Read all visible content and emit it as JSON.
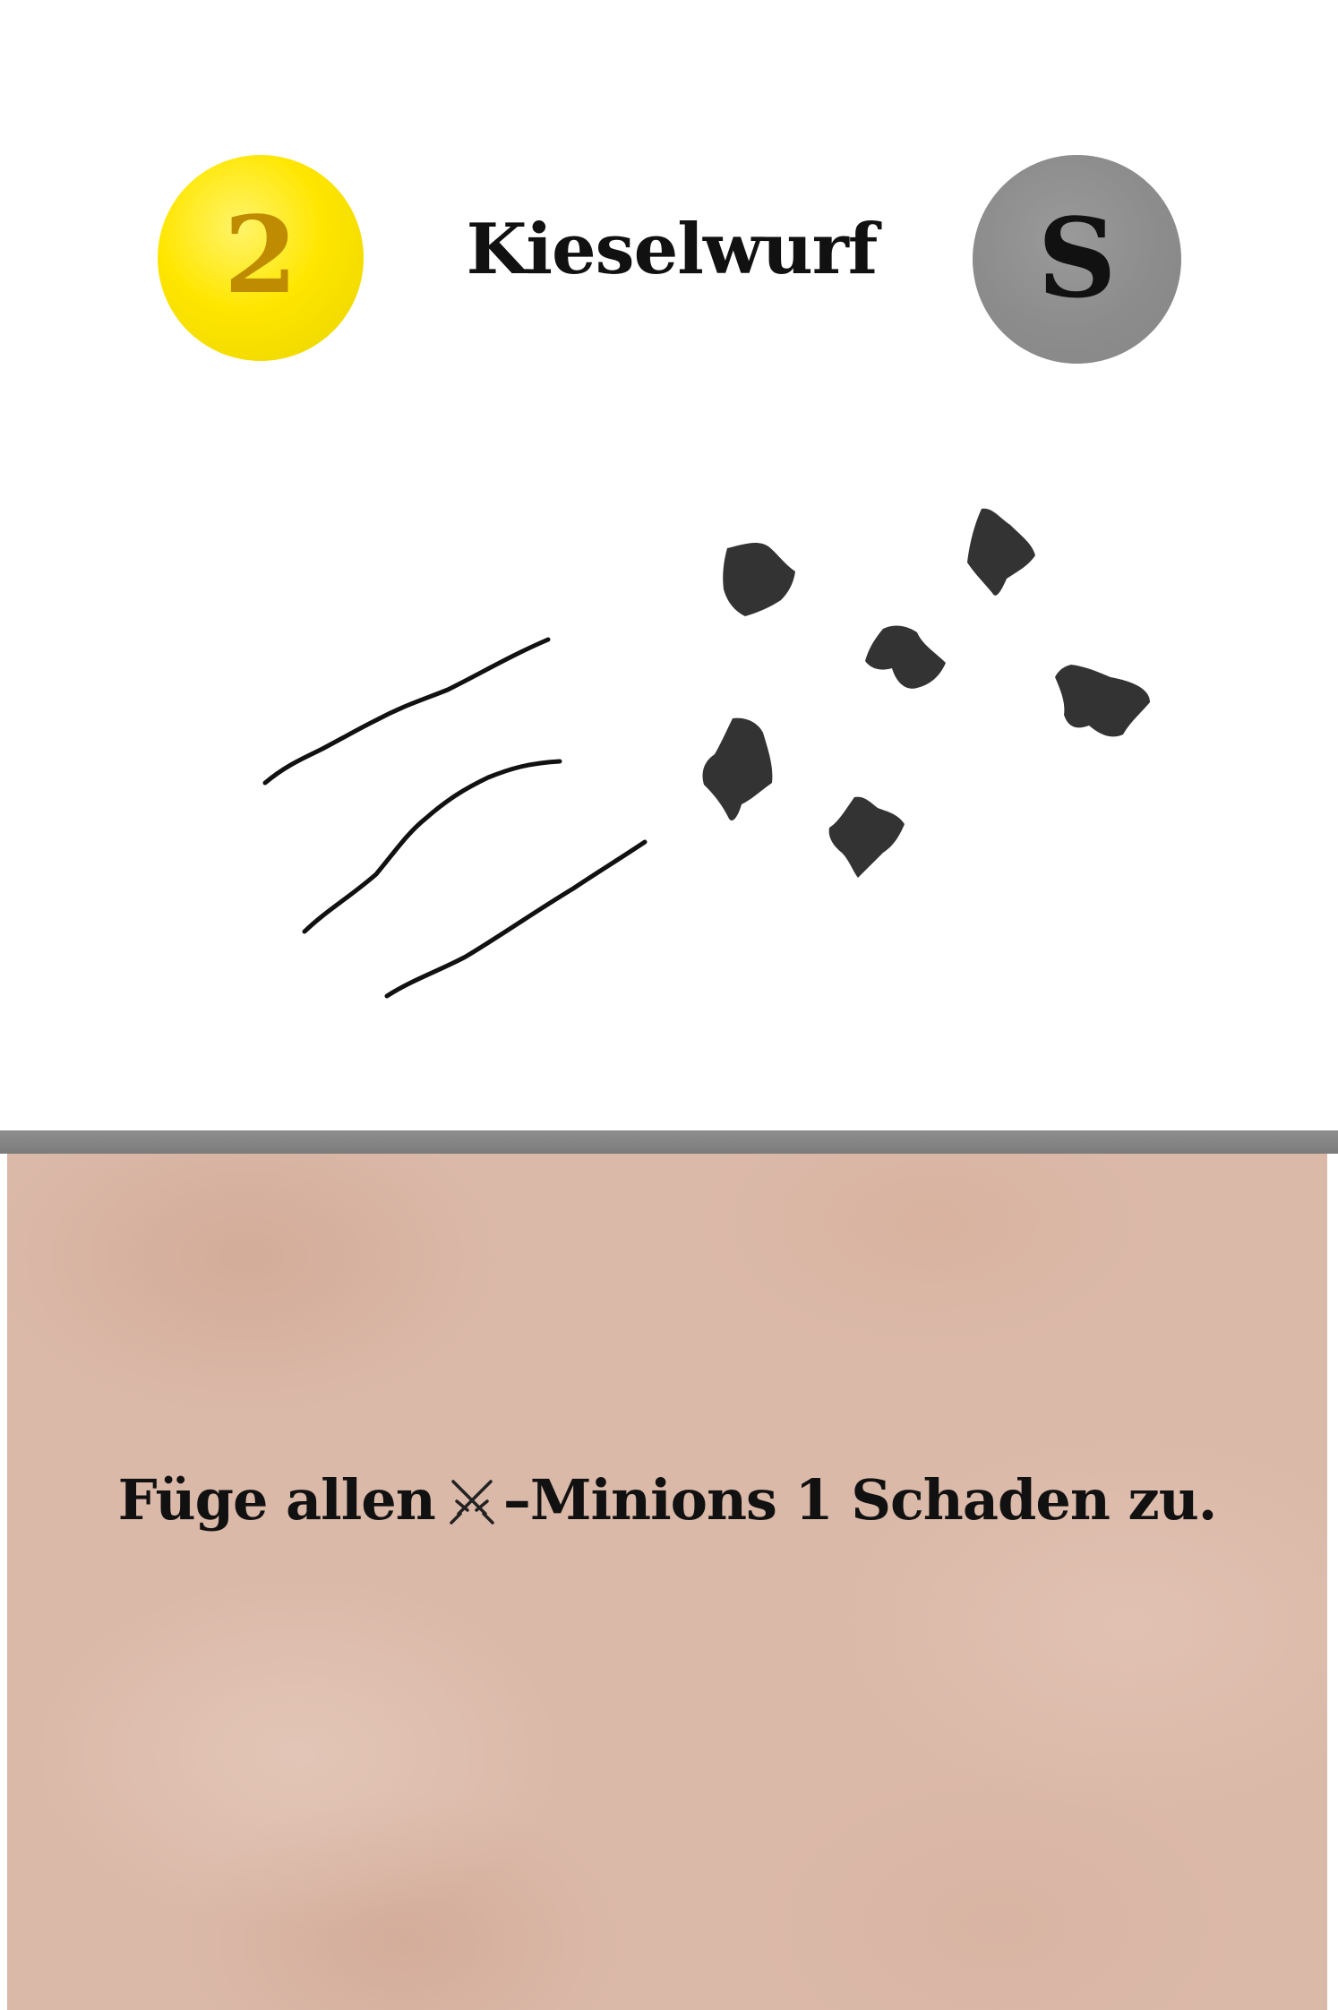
{
  "card": {
    "title": "Kieselwurf",
    "cost": "2",
    "cost_badge_color": "#ffe600",
    "cost_text_color": "#bf8b00",
    "type": "S",
    "type_badge_color": "#8c8c8c",
    "effect": {
      "before_icon": "Füge allen",
      "icon": "crossed-swords-icon",
      "after_icon": "–Minions 1 Schaden zu."
    },
    "panel_color": "#dbb9a9",
    "divider_color": "#858585"
  }
}
